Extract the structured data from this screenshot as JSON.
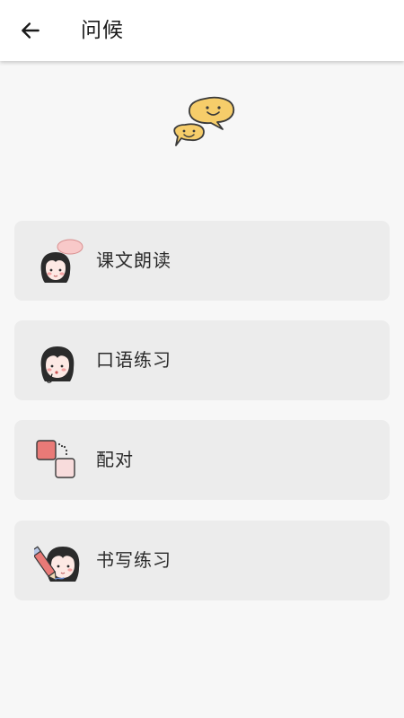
{
  "header": {
    "title": "问候",
    "back_icon": "arrow-left-icon"
  },
  "hero": {
    "icon": "chat-bubbles-smiley-icon",
    "colors": {
      "bubble": "#f6cd6a",
      "stroke": "#3a3a3a"
    }
  },
  "menu": {
    "items": [
      {
        "label": "课文朗读",
        "icon": "girl-speech-bubble-icon"
      },
      {
        "label": "口语练习",
        "icon": "girl-speaking-icon"
      },
      {
        "label": "配对",
        "icon": "matching-squares-icon"
      },
      {
        "label": "书写练习",
        "icon": "girl-pencil-icon"
      }
    ]
  },
  "colors": {
    "background": "#f7f7f7",
    "card": "#ececec",
    "accent_pink": "#e97a77",
    "light_pink": "#f8dcdc"
  }
}
